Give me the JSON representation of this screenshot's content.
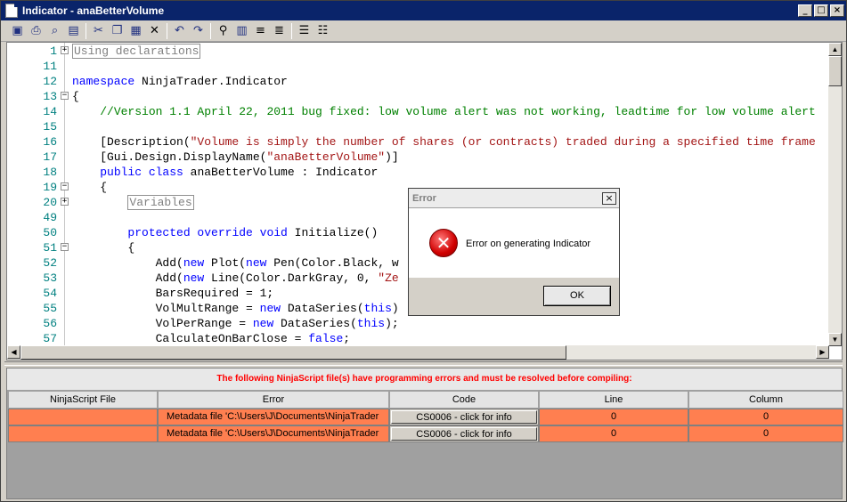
{
  "window": {
    "title": "Indicator - anaBetterVolume",
    "buttons": [
      "_",
      "□",
      "×"
    ]
  },
  "toolbar": {
    "icons": [
      "save-icon",
      "print-icon",
      "print-preview-icon",
      "undo-history-icon",
      "cut-icon",
      "copy-icon",
      "paste-icon",
      "delete-icon",
      "undo-icon",
      "redo-icon",
      "find-icon",
      "numbers-icon",
      "indent-icon",
      "outdent-icon",
      "comment-icon",
      "uncomment-icon"
    ]
  },
  "editor": {
    "lines": [
      {
        "n": "1",
        "fold": "+",
        "html": "<span class='rg'>Using declarations</span>"
      },
      {
        "n": "11",
        "fold": "",
        "html": ""
      },
      {
        "n": "12",
        "fold": "",
        "html": "<span class='kw'>namespace</span> NinjaTrader.Indicator"
      },
      {
        "n": "13",
        "fold": "−",
        "html": "{"
      },
      {
        "n": "14",
        "fold": "",
        "html": "    <span class='cm'>//Version 1.1 April 22, 2011 bug fixed: low volume alert was not working, leadtime for low volume alert</span>"
      },
      {
        "n": "15",
        "fold": "",
        "html": ""
      },
      {
        "n": "16",
        "fold": "",
        "html": "    [Description(<span class='st'>\"Volume is simply the number of shares (or contracts) traded during a specified time frame</span>"
      },
      {
        "n": "17",
        "fold": "",
        "html": "    [Gui.Design.DisplayName(<span class='st'>\"anaBetterVolume\"</span>)]"
      },
      {
        "n": "18",
        "fold": "",
        "html": "    <span class='kw'>public class</span> anaBetterVolume : Indicator"
      },
      {
        "n": "19",
        "fold": "−",
        "html": "    {"
      },
      {
        "n": "20",
        "fold": "+",
        "html": "        <span class='rg'>Variables</span>"
      },
      {
        "n": "49",
        "fold": "",
        "html": ""
      },
      {
        "n": "50",
        "fold": "",
        "html": "        <span class='kw'>protected override void</span> Initialize()"
      },
      {
        "n": "51",
        "fold": "−",
        "html": "        {"
      },
      {
        "n": "52",
        "fold": "",
        "html": "            Add(<span class='kw'>new</span> Plot(<span class='kw'>new</span> Pen(Color.Black, w                    <span class='st'>Volume\"</span>));"
      },
      {
        "n": "53",
        "fold": "",
        "html": "            Add(<span class='kw'>new</span> Line(Color.DarkGray, 0, <span class='st'>\"Ze</span>"
      },
      {
        "n": "54",
        "fold": "",
        "html": "            BarsRequired = 1;"
      },
      {
        "n": "55",
        "fold": "",
        "html": "            VolMultRange = <span class='kw'>new</span> DataSeries(<span class='kw'>this</span>)"
      },
      {
        "n": "56",
        "fold": "",
        "html": "            VolPerRange = <span class='kw'>new</span> DataSeries(<span class='kw'>this</span>);"
      },
      {
        "n": "57",
        "fold": "",
        "html": "            CalculateOnBarClose = <span class='kw'>false</span>;"
      }
    ]
  },
  "errors": {
    "header": "The following NinjaScript file(s) have programming errors and must be resolved before compiling:",
    "columns": [
      "NinjaScript File",
      "Error",
      "Code",
      "Line",
      "Column"
    ],
    "rows": [
      {
        "file": "",
        "error": "Metadata file 'C:\\Users\\J\\Documents\\NinjaTrader",
        "code": "CS0006 - click for info",
        "line": "0",
        "column": "0"
      },
      {
        "file": "",
        "error": "Metadata file 'C:\\Users\\J\\Documents\\NinjaTrader",
        "code": "CS0006 - click for info",
        "line": "0",
        "column": "0"
      }
    ]
  },
  "dialog": {
    "title": "Error",
    "message": "Error on generating Indicator",
    "ok": "OK",
    "close": "×"
  },
  "colors": {
    "title_bar": "#0a246a",
    "error_row": "#ff7f50",
    "error_text": "#ff0000"
  }
}
